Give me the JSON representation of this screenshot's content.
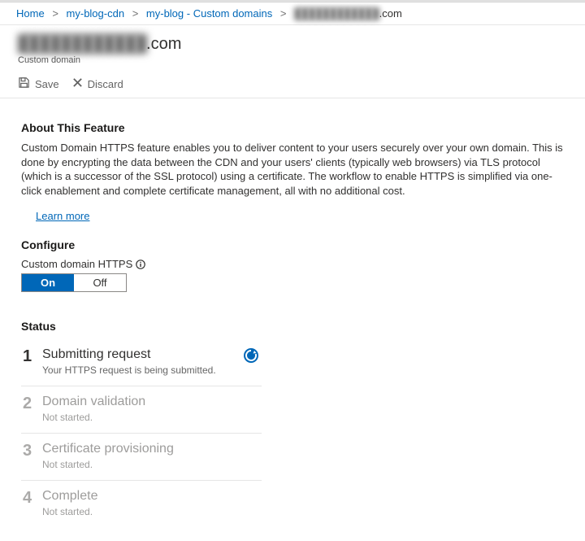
{
  "breadcrumb": {
    "home": "Home",
    "cdn": "my-blog-cdn",
    "custom_domains": "my-blog - Custom domains",
    "current_masked": "████████████",
    "current_suffix": ".com"
  },
  "header": {
    "title_masked": "████████████",
    "title_suffix": ".com",
    "subtitle": "Custom domain"
  },
  "toolbar": {
    "save": "Save",
    "discard": "Discard"
  },
  "about": {
    "heading": "About This Feature",
    "body": "Custom Domain HTTPS feature enables you to deliver content to your users securely over your own domain. This is done by encrypting the data between the CDN and your users' clients (typically web browsers) via TLS protocol (which is a successor of the SSL protocol) using a certificate. The workflow to enable HTTPS is simplified via one-click enablement and complete certificate management, all with no additional cost.",
    "learn_more": "Learn more"
  },
  "configure": {
    "heading": "Configure",
    "label": "Custom domain HTTPS",
    "on": "On",
    "off": "Off",
    "selected": "On"
  },
  "status": {
    "heading": "Status",
    "steps": [
      {
        "num": "1",
        "title": "Submitting request",
        "sub": "Your HTTPS request is being submitted.",
        "active": true,
        "spinner": true
      },
      {
        "num": "2",
        "title": "Domain validation",
        "sub": "Not started.",
        "active": false
      },
      {
        "num": "3",
        "title": "Certificate provisioning",
        "sub": "Not started.",
        "active": false
      },
      {
        "num": "4",
        "title": "Complete",
        "sub": "Not started.",
        "active": false
      }
    ]
  }
}
